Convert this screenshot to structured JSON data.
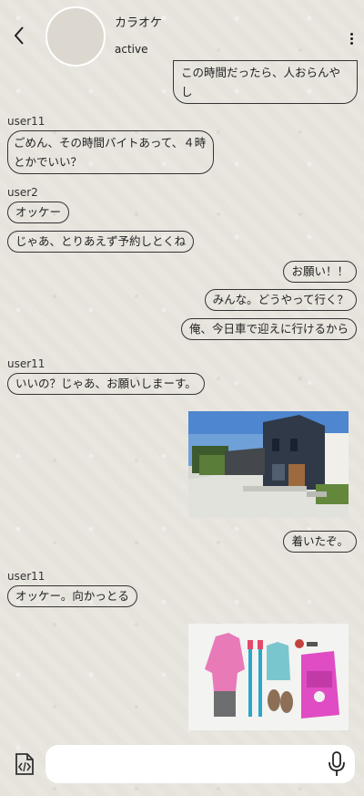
{
  "header": {
    "title": "カラオケ",
    "status": "active"
  },
  "messages": [
    {
      "side": "right",
      "text": "この時間だったら、人おらんやし"
    },
    {
      "sender": "user11",
      "side": "left",
      "text": "ごめん、その時間バイトあって、４時とかでいい？"
    },
    {
      "sender": "user2",
      "side": "left",
      "text": "オッケー"
    },
    {
      "side": "left",
      "text": "じゃあ、とりあえず予約しとくね"
    },
    {
      "side": "right",
      "text": "お願い！！"
    },
    {
      "side": "right",
      "text": "みんな。どうやって行く？"
    },
    {
      "side": "right",
      "text": "俺、今日車で迎えに行けるから"
    },
    {
      "sender": "user11",
      "side": "left",
      "text": "いいの？じゃあ、お願いしまーす。"
    },
    {
      "side": "right",
      "image": "house-photo"
    },
    {
      "side": "right",
      "text": "着いたぞ。"
    },
    {
      "sender": "user11",
      "side": "left",
      "text": "オッケー。向かっとる"
    },
    {
      "side": "right",
      "image": "hiking-gear-photo"
    }
  ],
  "composer": {
    "placeholder": "",
    "attach_icon": "file-code-icon",
    "mic_icon": "microphone-icon"
  }
}
